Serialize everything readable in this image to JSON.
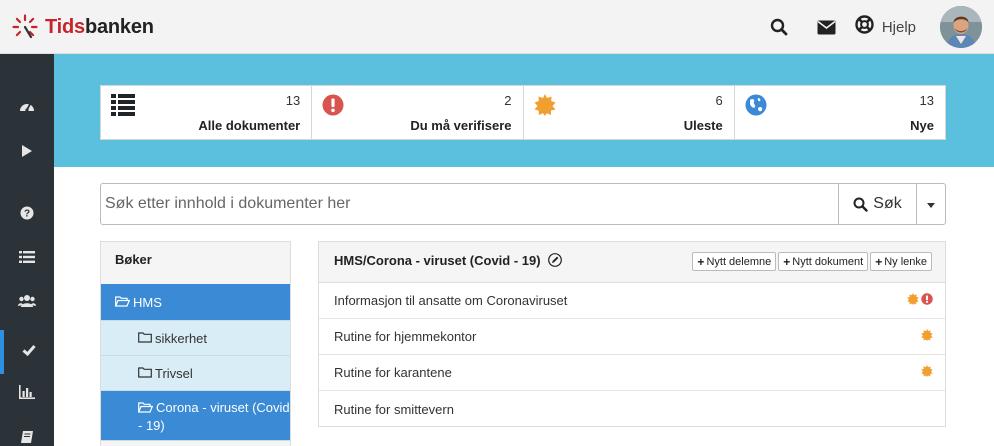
{
  "brand": {
    "name_part1": "Tids",
    "name_part2": "banken",
    "accent": "#c8232c"
  },
  "header": {
    "search_icon": "search-icon",
    "mail_icon": "envelope-icon",
    "help_label": "Hjelp"
  },
  "sidebar": {
    "items": [
      {
        "icon": "dashboard-icon"
      },
      {
        "icon": "play-icon"
      },
      {
        "icon": "question-icon"
      },
      {
        "icon": "list-icon"
      },
      {
        "icon": "users-icon"
      },
      {
        "icon": "check-icon",
        "active": true
      },
      {
        "icon": "bar-chart-icon"
      },
      {
        "icon": "book-icon"
      }
    ]
  },
  "stats": [
    {
      "count": "13",
      "label": "Alle dokumenter",
      "icon": "list-icon"
    },
    {
      "count": "2",
      "label": "Du må verifisere",
      "icon": "exclamation-icon"
    },
    {
      "count": "6",
      "label": "Uleste",
      "icon": "certificate-icon"
    },
    {
      "count": "13",
      "label": "Nye",
      "icon": "globe-icon"
    }
  ],
  "search": {
    "placeholder": "Søk etter innhold i dokumenter her",
    "button_label": "Søk"
  },
  "books": {
    "heading": "Bøker",
    "items": [
      {
        "label": "HMS",
        "level": 0,
        "active": true
      },
      {
        "label": "sikkerhet",
        "level": 1
      },
      {
        "label": "Trivsel",
        "level": 1
      },
      {
        "label": "Corona - viruset (Covid - 19)",
        "level": 1,
        "active": true
      }
    ]
  },
  "documents": {
    "title": "HMS/Corona - viruset (Covid - 19)",
    "actions": [
      "Nytt delemne",
      "Nytt dokument",
      "Ny lenke"
    ],
    "rows": [
      {
        "title": "Informasjon til ansatte om Coronaviruset",
        "unread": true,
        "verify": true
      },
      {
        "title": "Rutine for hjemmekontor",
        "unread": true,
        "verify": false
      },
      {
        "title": "Rutine for karantene",
        "unread": true,
        "verify": false
      },
      {
        "title": "Rutine for smittevern",
        "unread": false,
        "verify": false
      }
    ]
  },
  "colors": {
    "hero": "#5bc0de",
    "primary": "#3a8ad6",
    "sidebar": "#2b3238",
    "unread": "#f0a030",
    "verify": "#d9534f"
  }
}
